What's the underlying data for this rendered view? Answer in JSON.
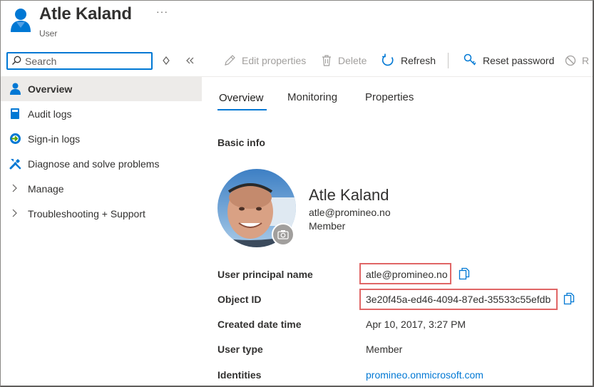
{
  "header": {
    "title": "Atle Kaland",
    "subtitle": "User",
    "more": "···"
  },
  "search": {
    "placeholder": "Search"
  },
  "nav_controls": {
    "sort": "◇",
    "collapse": "«"
  },
  "nav": {
    "items": [
      {
        "label": "Overview"
      },
      {
        "label": "Audit logs"
      },
      {
        "label": "Sign-in logs"
      },
      {
        "label": "Diagnose and solve problems"
      },
      {
        "label": "Manage"
      },
      {
        "label": "Troubleshooting + Support"
      }
    ]
  },
  "toolbar": {
    "edit": "Edit properties",
    "delete": "Delete",
    "refresh": "Refresh",
    "reset": "Reset password",
    "revoke": "R"
  },
  "tabs": [
    {
      "label": "Overview"
    },
    {
      "label": "Monitoring"
    },
    {
      "label": "Properties"
    }
  ],
  "section": {
    "title": "Basic info"
  },
  "profile": {
    "name": "Atle Kaland",
    "email": "atle@promineo.no",
    "role": "Member"
  },
  "properties": [
    {
      "label": "User principal name",
      "value": "atle@promineo.no"
    },
    {
      "label": "Object ID",
      "value": "3e20f45a-ed46-4094-87ed-35533c55efdb"
    },
    {
      "label": "Created date time",
      "value": "Apr 10, 2017, 3:27 PM"
    },
    {
      "label": "User type",
      "value": "Member"
    },
    {
      "label": "Identities",
      "value": "promineo.onmicrosoft.com"
    }
  ],
  "colors": {
    "accent": "#0078d4",
    "highlight_box": "#e06666",
    "active_nav_bg": "#edebe9"
  },
  "icons": {
    "header": "user-icon",
    "search": "search-icon",
    "edit": "pencil-icon",
    "delete": "trash-icon",
    "refresh": "refresh-icon",
    "reset": "key-person-icon",
    "revoke": "block-icon",
    "copy": "copy-icon",
    "camera": "camera-icon"
  }
}
